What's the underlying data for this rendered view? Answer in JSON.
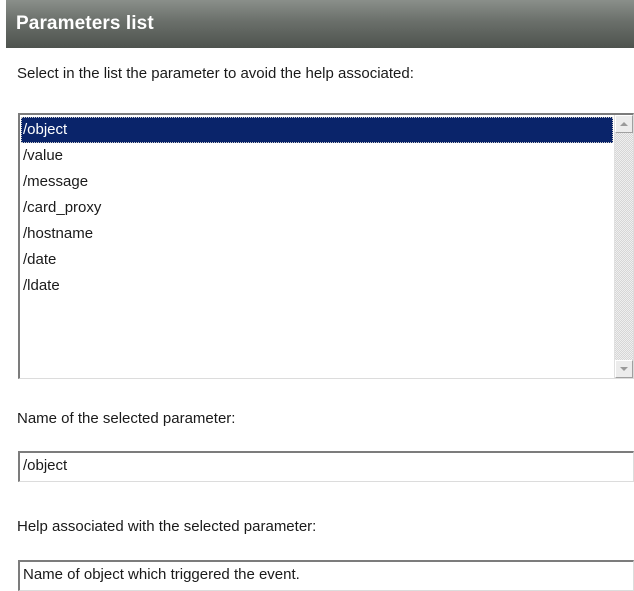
{
  "header": {
    "title": "Parameters list"
  },
  "list_section": {
    "instruction": "Select in the list the parameter to avoid the help associated:",
    "selected_index": 0,
    "items": [
      "/object",
      "/value",
      "/message",
      "/card_proxy",
      "/hostname",
      "/date",
      "/ldate"
    ]
  },
  "name_section": {
    "label": "Name of the selected parameter:",
    "value": "/object"
  },
  "help_section": {
    "label": "Help associated with the selected parameter:",
    "value": "Name of object which triggered the event."
  },
  "colors": {
    "header_gradient_top": "#8a8f8a",
    "header_gradient_bottom": "#4e534e",
    "selection_background": "#0a246a",
    "selection_text": "#ffffff"
  },
  "icons": {
    "scroll_up": "scroll-up-arrow-icon",
    "scroll_down": "scroll-down-arrow-icon"
  }
}
